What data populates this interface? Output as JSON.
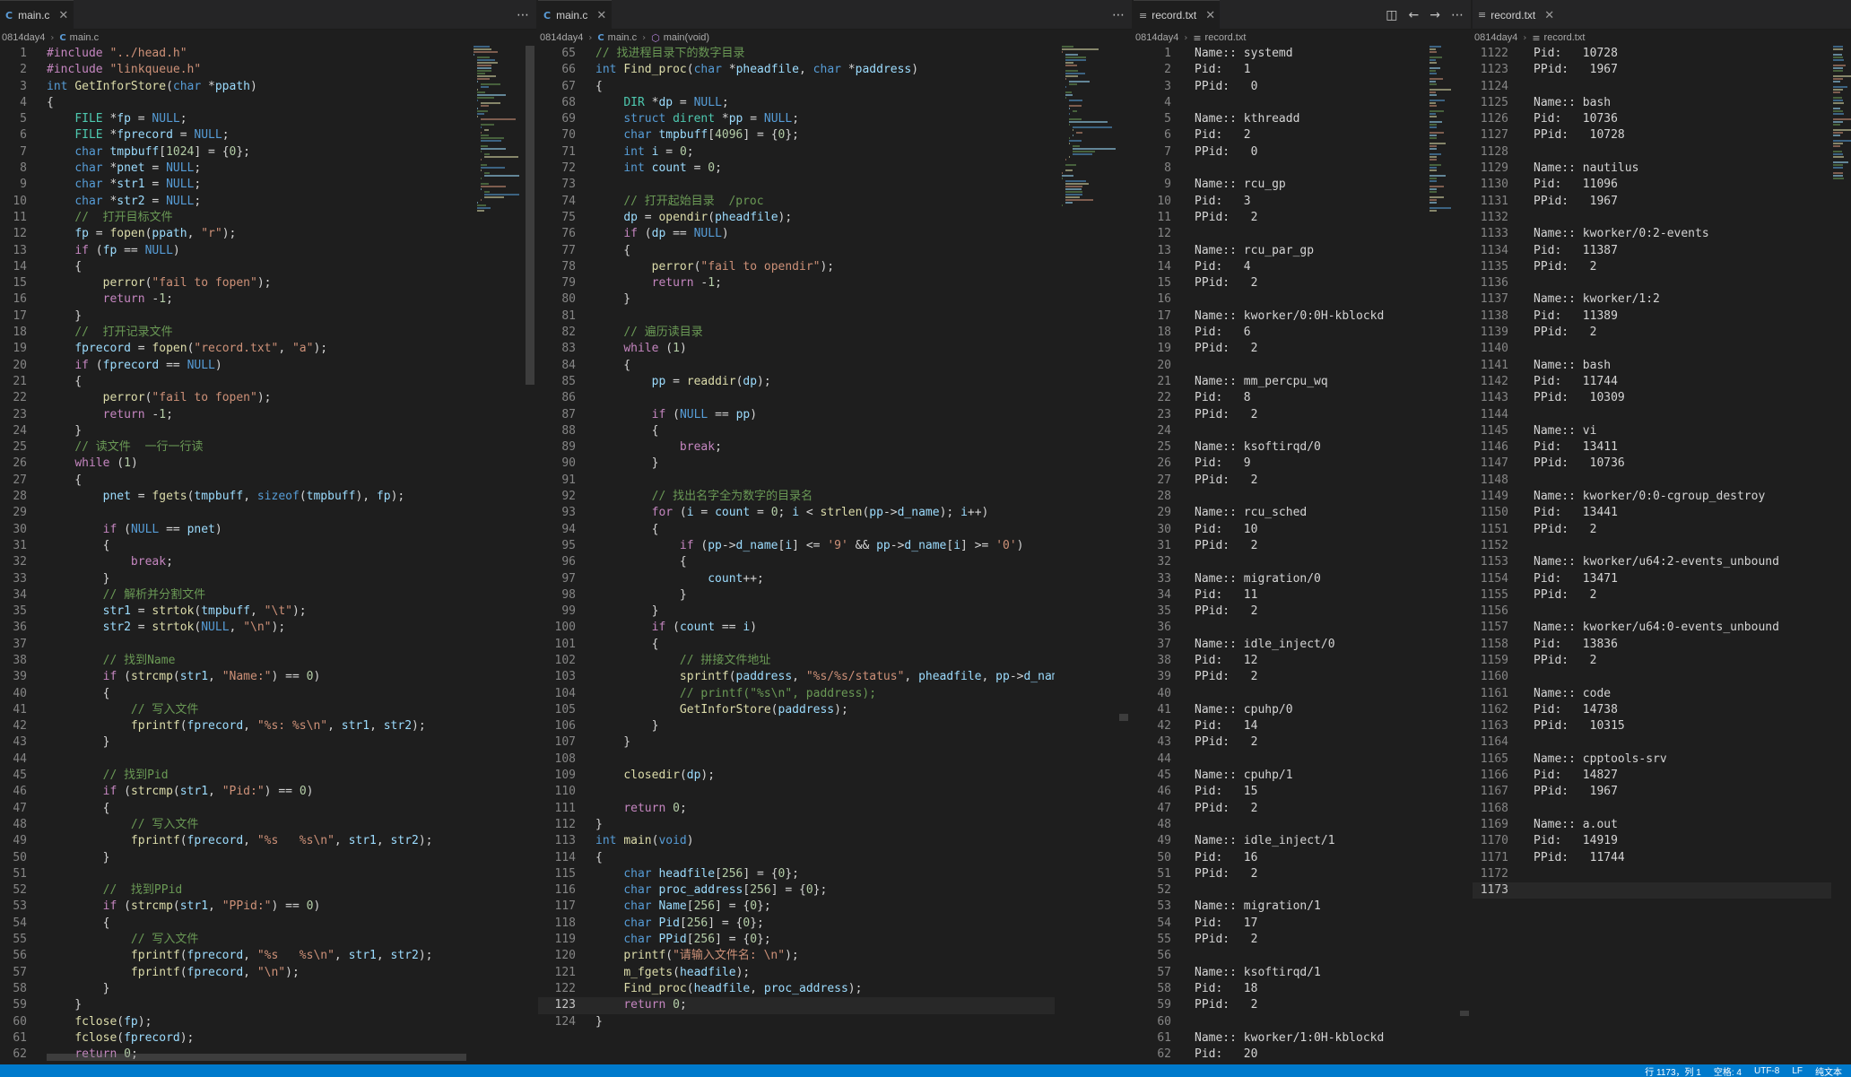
{
  "editors": [
    {
      "tabs": [
        {
          "name": "main.c",
          "type": "c",
          "active": true
        }
      ],
      "breadcrumb": [
        "0814day4",
        "main.c"
      ],
      "first_line": 1,
      "current_line": null,
      "lines": [
        "#include \"../head.h\"",
        "#include \"linkqueue.h\"",
        "int GetInforStore(char *ppath)",
        "{",
        "    FILE *fp = NULL;",
        "    FILE *fprecord = NULL;",
        "    char tmpbuff[1024] = {0};",
        "    char *pnet = NULL;",
        "    char *str1 = NULL;",
        "    char *str2 = NULL;",
        "    //  打开目标文件",
        "    fp = fopen(ppath, \"r\");",
        "    if (fp == NULL)",
        "    {",
        "        perror(\"fail to fopen\");",
        "        return -1;",
        "    }",
        "    //  打开记录文件",
        "    fprecord = fopen(\"record.txt\", \"a\");",
        "    if (fprecord == NULL)",
        "    {",
        "        perror(\"fail to fopen\");",
        "        return -1;",
        "    }",
        "    // 读文件  一行一行读",
        "    while (1)",
        "    {",
        "        pnet = fgets(tmpbuff, sizeof(tmpbuff), fp);",
        "",
        "        if (NULL == pnet)",
        "        {",
        "            break;",
        "        }",
        "        // 解析并分割文件",
        "        str1 = strtok(tmpbuff, \"\\t\");",
        "        str2 = strtok(NULL, \"\\n\");",
        "",
        "        // 找到Name",
        "        if (strcmp(str1, \"Name:\") == 0)",
        "        {",
        "            // 写入文件",
        "            fprintf(fprecord, \"%s: %s\\n\", str1, str2);",
        "        }",
        "",
        "        // 找到Pid",
        "        if (strcmp(str1, \"Pid:\") == 0)",
        "        {",
        "            // 写入文件",
        "            fprintf(fprecord, \"%s   %s\\n\", str1, str2);",
        "        }",
        "",
        "        //  找到PPid",
        "        if (strcmp(str1, \"PPid:\") == 0)",
        "        {",
        "            // 写入文件",
        "            fprintf(fprecord, \"%s   %s\\n\", str1, str2);",
        "            fprintf(fprecord, \"\\n\");",
        "        }",
        "    }",
        "    fclose(fp);",
        "    fclose(fprecord);",
        "    return 0;"
      ]
    },
    {
      "tabs": [
        {
          "name": "main.c",
          "type": "c",
          "active": true
        }
      ],
      "breadcrumb": [
        "0814day4",
        "main.c",
        "main(void)"
      ],
      "first_line": 65,
      "current_line": 123,
      "lines": [
        "// 找进程目录下的数字目录",
        "int Find_proc(char *pheadfile, char *paddress)",
        "{",
        "    DIR *dp = NULL;",
        "    struct dirent *pp = NULL;",
        "    char tmpbuff[4096] = {0};",
        "    int i = 0;",
        "    int count = 0;",
        "",
        "    // 打开起始目录  /proc",
        "    dp = opendir(pheadfile);",
        "    if (dp == NULL)",
        "    {",
        "        perror(\"fail to opendir\");",
        "        return -1;",
        "    }",
        "",
        "    // 遍历读目录",
        "    while (1)",
        "    {",
        "        pp = readdir(dp);",
        "",
        "        if (NULL == pp)",
        "        {",
        "            break;",
        "        }",
        "",
        "        // 找出名字全为数字的目录名",
        "        for (i = count = 0; i < strlen(pp->d_name); i++)",
        "        {",
        "            if (pp->d_name[i] <= '9' && pp->d_name[i] >= '0')",
        "            {",
        "                count++;",
        "            }",
        "        }",
        "        if (count == i)",
        "        {",
        "            // 拼接文件地址",
        "            sprintf(paddress, \"%s/%s/status\", pheadfile, pp->d_name);",
        "            // printf(\"%s\\n\", paddress);",
        "            GetInforStore(paddress);",
        "        }",
        "    }",
        "",
        "    closedir(dp);",
        "",
        "    return 0;",
        "}",
        "int main(void)",
        "{",
        "    char headfile[256] = {0};",
        "    char proc_address[256] = {0};",
        "    char Name[256] = {0};",
        "    char Pid[256] = {0};",
        "    char PPid[256] = {0};",
        "    printf(\"请输入文件名: \\n\");",
        "    m_fgets(headfile);",
        "    Find_proc(headfile, proc_address);",
        "    return 0;",
        "}"
      ]
    },
    {
      "tabs": [
        {
          "name": "record.txt",
          "type": "txt",
          "active": true
        }
      ],
      "breadcrumb": [
        "0814day4",
        "record.txt"
      ],
      "first_line": 1,
      "current_line": null,
      "lines": [
        "Name:: systemd",
        "Pid:   1",
        "PPid:   0",
        "",
        "Name:: kthreadd",
        "Pid:   2",
        "PPid:   0",
        "",
        "Name:: rcu_gp",
        "Pid:   3",
        "PPid:   2",
        "",
        "Name:: rcu_par_gp",
        "Pid:   4",
        "PPid:   2",
        "",
        "Name:: kworker/0:0H-kblockd",
        "Pid:   6",
        "PPid:   2",
        "",
        "Name:: mm_percpu_wq",
        "Pid:   8",
        "PPid:   2",
        "",
        "Name:: ksoftirqd/0",
        "Pid:   9",
        "PPid:   2",
        "",
        "Name:: rcu_sched",
        "Pid:   10",
        "PPid:   2",
        "",
        "Name:: migration/0",
        "Pid:   11",
        "PPid:   2",
        "",
        "Name:: idle_inject/0",
        "Pid:   12",
        "PPid:   2",
        "",
        "Name:: cpuhp/0",
        "Pid:   14",
        "PPid:   2",
        "",
        "Name:: cpuhp/1",
        "Pid:   15",
        "PPid:   2",
        "",
        "Name:: idle_inject/1",
        "Pid:   16",
        "PPid:   2",
        "",
        "Name:: migration/1",
        "Pid:   17",
        "PPid:   2",
        "",
        "Name:: ksoftirqd/1",
        "Pid:   18",
        "PPid:   2",
        "",
        "Name:: kworker/1:0H-kblockd",
        "Pid:   20"
      ]
    },
    {
      "tabs": [
        {
          "name": "record.txt",
          "type": "txt",
          "active": false
        }
      ],
      "breadcrumb": [
        "0814day4",
        "record.txt"
      ],
      "first_line": 1122,
      "current_line": 1173,
      "lines": [
        "Pid:   10728",
        "PPid:   1967",
        "",
        "Name:: bash",
        "Pid:   10736",
        "PPid:   10728",
        "",
        "Name:: nautilus",
        "Pid:   11096",
        "PPid:   1967",
        "",
        "Name:: kworker/0:2-events",
        "Pid:   11387",
        "PPid:   2",
        "",
        "Name:: kworker/1:2",
        "Pid:   11389",
        "PPid:   2",
        "",
        "Name:: bash",
        "Pid:   11744",
        "PPid:   10309",
        "",
        "Name:: vi",
        "Pid:   13411",
        "PPid:   10736",
        "",
        "Name:: kworker/0:0-cgroup_destroy",
        "Pid:   13441",
        "PPid:   2",
        "",
        "Name:: kworker/u64:2-events_unbound",
        "Pid:   13471",
        "PPid:   2",
        "",
        "Name:: kworker/u64:0-events_unbound",
        "Pid:   13836",
        "PPid:   2",
        "",
        "Name:: code",
        "Pid:   14738",
        "PPid:   10315",
        "",
        "Name:: cpptools-srv",
        "Pid:   14827",
        "PPid:   1967",
        "",
        "Name:: a.out",
        "Pid:   14919",
        "PPid:   11744",
        "",
        ""
      ]
    }
  ],
  "status_bar": [
    "行 1173，列 1",
    "空格: 4",
    "UTF-8",
    "LF",
    "纯文本"
  ],
  "theme": {
    "keyword": "#569cd6",
    "control": "#c586c0",
    "function": "#dcdcaa",
    "string": "#ce9178",
    "number": "#b5cea8",
    "comment": "#6a9955",
    "variable": "#9cdcfe",
    "type": "#4ec9b0",
    "plain": "#d4d4d4",
    "status_bg": "#007acc"
  }
}
